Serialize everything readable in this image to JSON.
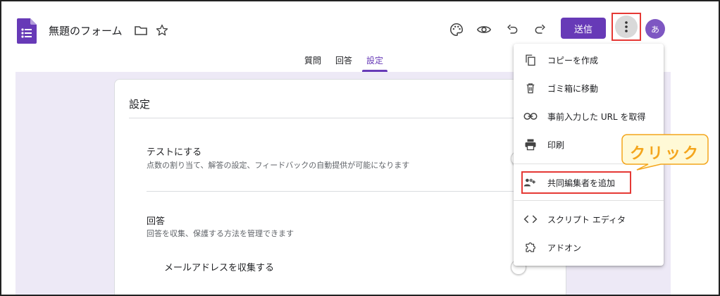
{
  "header": {
    "doc_title": "無題のフォーム",
    "send_label": "送信",
    "avatar_initial": "あ"
  },
  "tabs": [
    {
      "label": "質問"
    },
    {
      "label": "回答"
    },
    {
      "label": "設定"
    }
  ],
  "settings": {
    "heading": "設定",
    "quiz": {
      "title": "テストにする",
      "description": "点数の割り当て、解答の設定、フィードバックの自動提供が可能になります"
    },
    "responses": {
      "title": "回答",
      "description": "回答を収集、保護する方法を管理できます"
    },
    "collect_email": {
      "title": "メールアドレスを収集する"
    }
  },
  "menu": {
    "items": [
      {
        "label": "コピーを作成",
        "icon": "copy-icon"
      },
      {
        "label": "ゴミ箱に移動",
        "icon": "trash-icon"
      },
      {
        "label": "事前入力した URL を取得",
        "icon": "link-icon"
      },
      {
        "label": "印刷",
        "icon": "print-icon"
      },
      {
        "label": "共同編集者を追加",
        "icon": "add-collaborator-icon"
      },
      {
        "label": "スクリプト エディタ",
        "icon": "code-icon"
      },
      {
        "label": "アドオン",
        "icon": "puzzle-icon"
      }
    ]
  },
  "annotation": {
    "callout_text": "クリック"
  },
  "colors": {
    "accent": "#673ab7",
    "highlight": "#e53935",
    "callout_fill": "#fff9d6",
    "callout_border": "#f4a51c",
    "background": "#ede9f6"
  }
}
